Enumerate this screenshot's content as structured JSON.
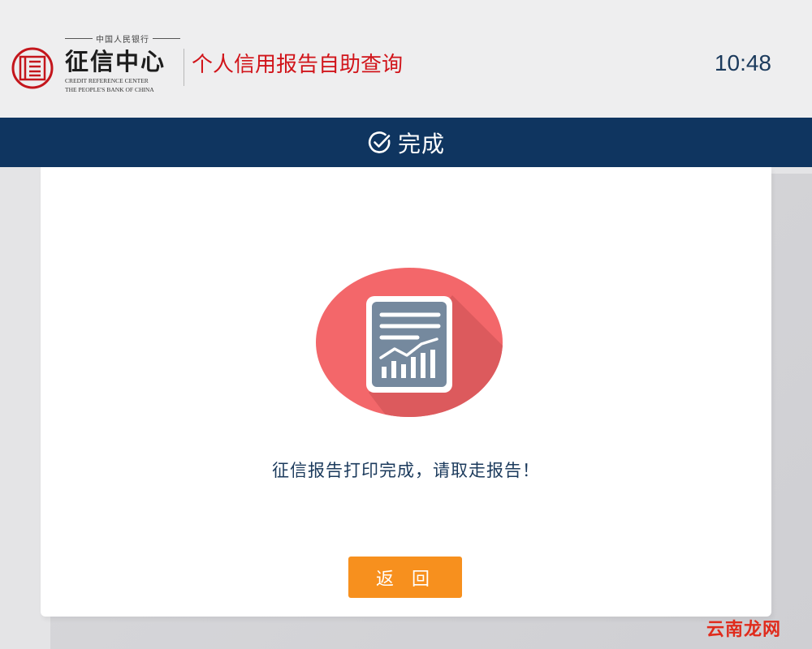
{
  "header": {
    "logo": {
      "org_cn": "中国人民银行",
      "name_cn": "征信中心",
      "name_en_line1": "CREDIT REFERENCE CENTER",
      "name_en_line2": "THE PEOPLE'S BANK OF CHINA"
    },
    "app_title": "个人信用报告自助查询",
    "clock": "10:48"
  },
  "title_bar": {
    "icon": "check-circle-icon",
    "title": "完成"
  },
  "main": {
    "badge_icon": "report-chart-icon",
    "message": "征信报告打印完成，请取走报告！",
    "back_button_label": "返回"
  },
  "watermark": "云南龙网",
  "colors": {
    "title_bar": "#0f3560",
    "app_title": "#d1141a",
    "button": "#f7901e",
    "badge_circle": "#f3676a",
    "badge_document": "#75899e"
  }
}
